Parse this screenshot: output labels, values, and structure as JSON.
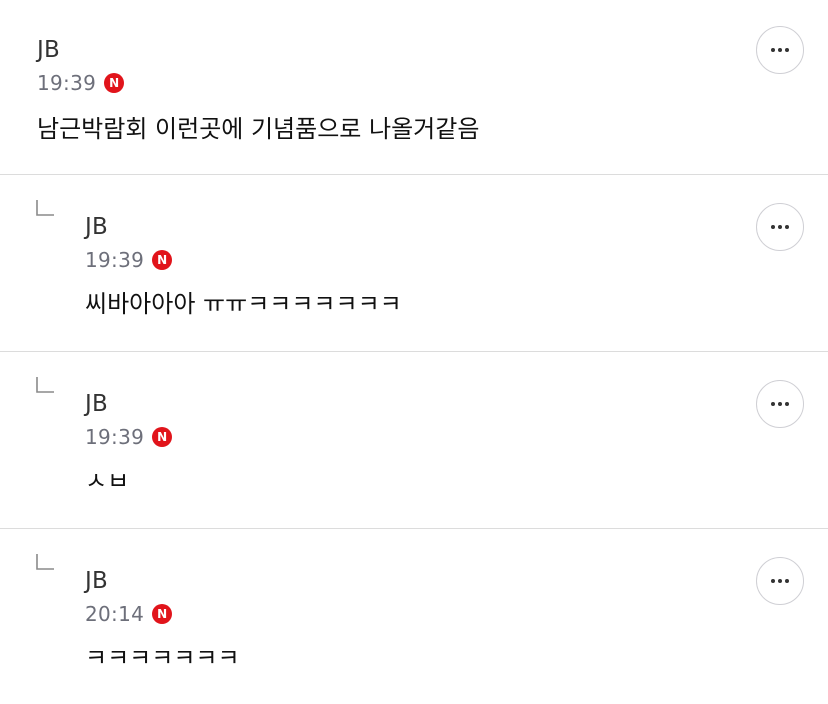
{
  "comments": [
    {
      "author": "JB",
      "time": "19:39",
      "badge": "N",
      "text": "남근박람회 이런곳에 기념품으로 나올거같음",
      "is_reply": false
    },
    {
      "author": "JB",
      "time": "19:39",
      "badge": "N",
      "text": "씨바아아아 ㅠㅠㅋㅋㅋㅋㅋㅋㅋ",
      "is_reply": true
    },
    {
      "author": "JB",
      "time": "19:39",
      "badge": "N",
      "text": "ㅅㅂ",
      "is_reply": true
    },
    {
      "author": "JB",
      "time": "20:14",
      "badge": "N",
      "text": "ㅋㅋㅋㅋㅋㅋㅋ",
      "is_reply": true
    }
  ],
  "icons": {
    "more": "more-options-icon",
    "reply": "reply-arrow-icon",
    "new_badge": "new-badge-icon"
  },
  "colors": {
    "badge": "#e1141b",
    "time": "#6d6f7a",
    "divider": "#dcdcdc"
  }
}
